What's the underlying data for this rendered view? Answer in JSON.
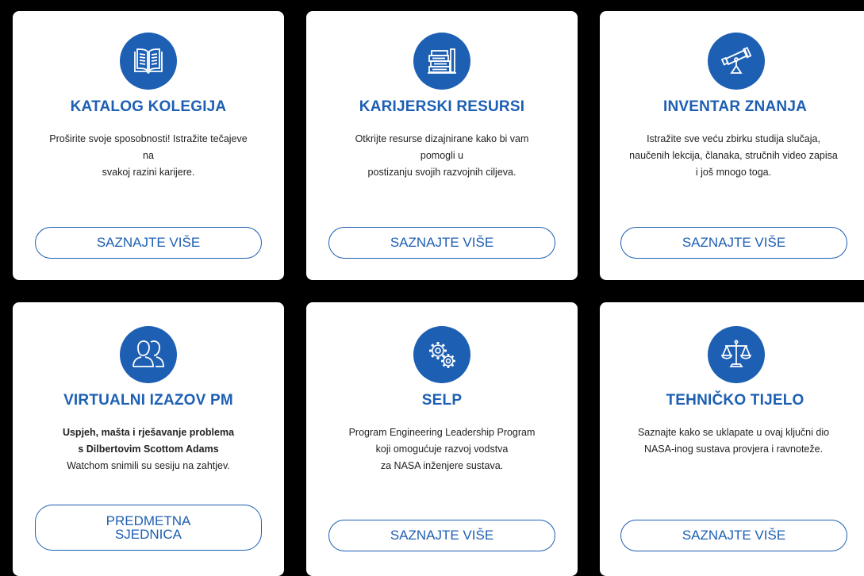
{
  "colors": {
    "accent": "#1d5fb3",
    "background": "#000000",
    "card": "#ffffff"
  },
  "cards": [
    {
      "icon": "book-icon",
      "title": "KATALOG KOLEGIJA",
      "desc": [
        "Proširite svoje sposobnosti! Istražite tečajeve",
        "na",
        "svakoj razini karijere."
      ],
      "button": [
        "SAZNAJTE VIŠE"
      ]
    },
    {
      "icon": "books-stack-icon",
      "title": "KARIJERSKI RESURSI",
      "desc": [
        "Otkrijte resurse dizajnirane kako bi vam",
        "pomogli u",
        "postizanju svojih razvojnih ciljeva."
      ],
      "button": [
        "SAZNAJTE VIŠE"
      ]
    },
    {
      "icon": "telescope-icon",
      "title": "INVENTAR ZNANJA",
      "desc": [
        "Istražite sve veću zbirku studija slučaja,",
        "naučenih lekcija, članaka, stručnih video zapisa",
        "i još mnogo toga."
      ],
      "button": [
        "SAZNAJTE VIŠE"
      ]
    },
    {
      "icon": "people-icon",
      "title": "VIRTUALNI IZAZOV PM",
      "desc": [
        "Uspjeh, mašta i rješavanje problema",
        "s Dilbertovim Scottom Adams",
        "Watchom snimili su sesiju na zahtjev."
      ],
      "button": [
        "PREDMETNA",
        "SJEDNICA"
      ]
    },
    {
      "icon": "gears-icon",
      "title": "SELP",
      "desc": [
        "Program Engineering Leadership Program",
        "koji omogućuje razvoj vodstva",
        "za NASA inženjere sustava."
      ],
      "button": [
        "SAZNAJTE VIŠE"
      ]
    },
    {
      "icon": "scales-icon",
      "title": "TEHNIČKO TIJELO",
      "desc": [
        "Saznajte kako se uklapate u ovaj ključni dio",
        "NASA-inog sustava provjera i ravnoteže."
      ],
      "button": [
        "SAZNAJTE VIŠE"
      ]
    }
  ]
}
